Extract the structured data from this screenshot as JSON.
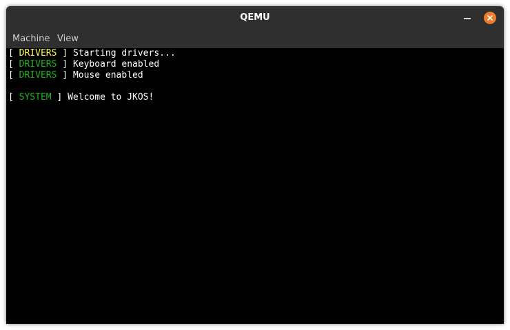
{
  "window": {
    "title": "QEMU"
  },
  "menu": {
    "items": [
      "Machine",
      "View"
    ]
  },
  "colors": {
    "titlebar": "#2f2f2f",
    "close_button": "#ec7c2a",
    "tag_yellow": "#ffff55",
    "tag_green": "#22b322",
    "text": "#ffffff"
  },
  "console": {
    "lines": [
      {
        "open": "[ ",
        "tag": "DRIVERS",
        "tag_color": "yellow",
        "close": " ] ",
        "message": "Starting drivers..."
      },
      {
        "open": "[ ",
        "tag": "DRIVERS",
        "tag_color": "green",
        "close": " ] ",
        "message": "Keyboard enabled"
      },
      {
        "open": "[ ",
        "tag": "DRIVERS",
        "tag_color": "green",
        "close": " ] ",
        "message": "Mouse enabled"
      },
      {
        "open": "[ ",
        "tag": "SYSTEM",
        "tag_color": "green",
        "close": " ] ",
        "message": "Welcome to JKOS!"
      }
    ]
  },
  "icons": {
    "minimize": "minimize-icon",
    "close": "close-icon"
  }
}
